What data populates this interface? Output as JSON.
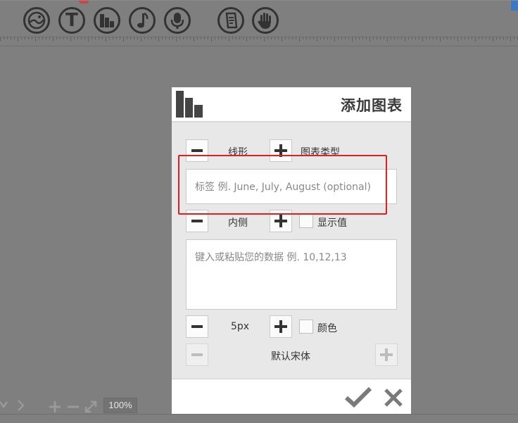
{
  "toolbar": {
    "tools": [
      {
        "icon": "photo-icon"
      },
      {
        "icon": "text-icon"
      },
      {
        "icon": "chart-icon"
      },
      {
        "icon": "music-note-icon"
      },
      {
        "icon": "microphone-icon"
      },
      {
        "icon": "document-icon"
      },
      {
        "icon": "hand-icon"
      }
    ],
    "text_glyph": "T"
  },
  "dialog": {
    "title": "添加图表",
    "chart_type": {
      "value": "线形",
      "label": "图表类型"
    },
    "labels_field": {
      "placeholder": "标签 例. June, July, August (optional)"
    },
    "value_position": {
      "value": "内侧",
      "show_values_label": "显示值"
    },
    "data_field": {
      "placeholder": "键入或粘贴您的数据 例. 10,12,13"
    },
    "line_width": {
      "value": "5px",
      "color_label": "颜色"
    },
    "font": {
      "value": "默认宋体"
    },
    "footer": {
      "confirm_icon": "checkmark-icon",
      "cancel_icon": "close-icon"
    }
  },
  "status": {
    "zoom": "100%"
  },
  "colors": {
    "background": "#7f7f7f",
    "dialog_body": "#e8e8e8",
    "highlight": "#e02020",
    "icon": "#333333"
  }
}
